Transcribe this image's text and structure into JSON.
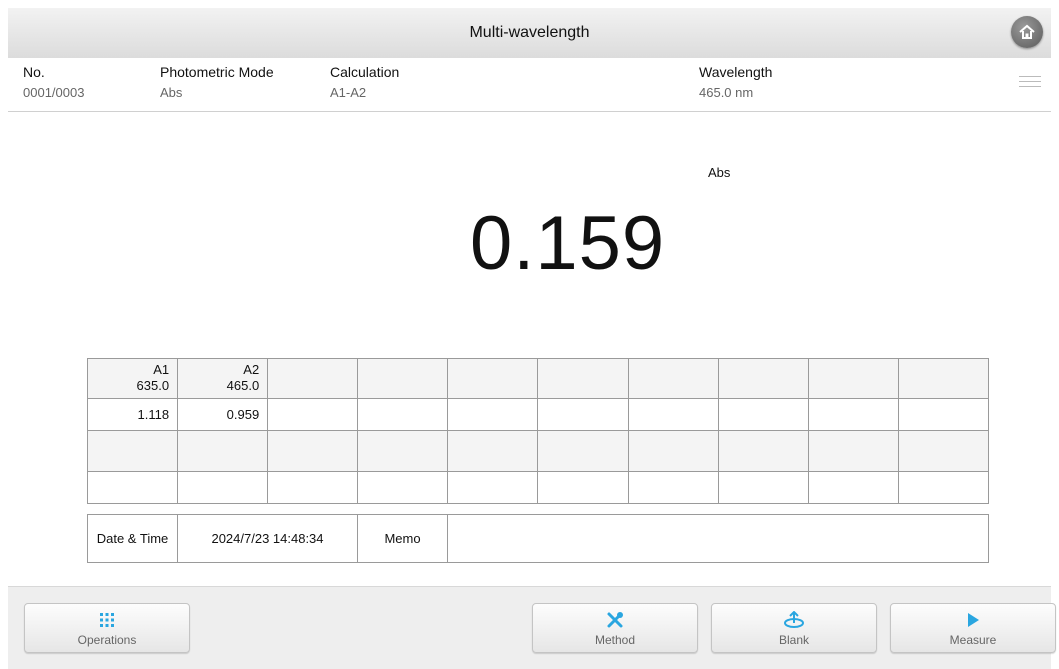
{
  "title": "Multi-wavelength",
  "info": {
    "no_label": "No.",
    "no_value": "0001/0003",
    "mode_label": "Photometric Mode",
    "mode_value": "Abs",
    "calc_label": "Calculation",
    "calc_value": "A1-A2",
    "wl_label": "Wavelength",
    "wl_value": "465.0 nm"
  },
  "main": {
    "unit": "Abs",
    "value": "0.159"
  },
  "table": {
    "headers": [
      {
        "name": "A1",
        "wl": "635.0"
      },
      {
        "name": "A2",
        "wl": "465.0"
      }
    ],
    "row1": [
      "1.118",
      "0.959"
    ]
  },
  "meta": {
    "datetime_label": "Date & Time",
    "datetime_value": "2024/7/23 14:48:34",
    "memo_label": "Memo",
    "memo_value": ""
  },
  "buttons": {
    "operations": "Operations",
    "method": "Method",
    "blank": "Blank",
    "measure": "Measure"
  },
  "colors": {
    "accent": "#2aa6e0"
  },
  "icons": {
    "home": "home-icon",
    "menu": "list-icon",
    "operations": "dots-grid-icon",
    "method": "tools-icon",
    "blank": "blank-cuvette-icon",
    "measure": "play-icon"
  }
}
